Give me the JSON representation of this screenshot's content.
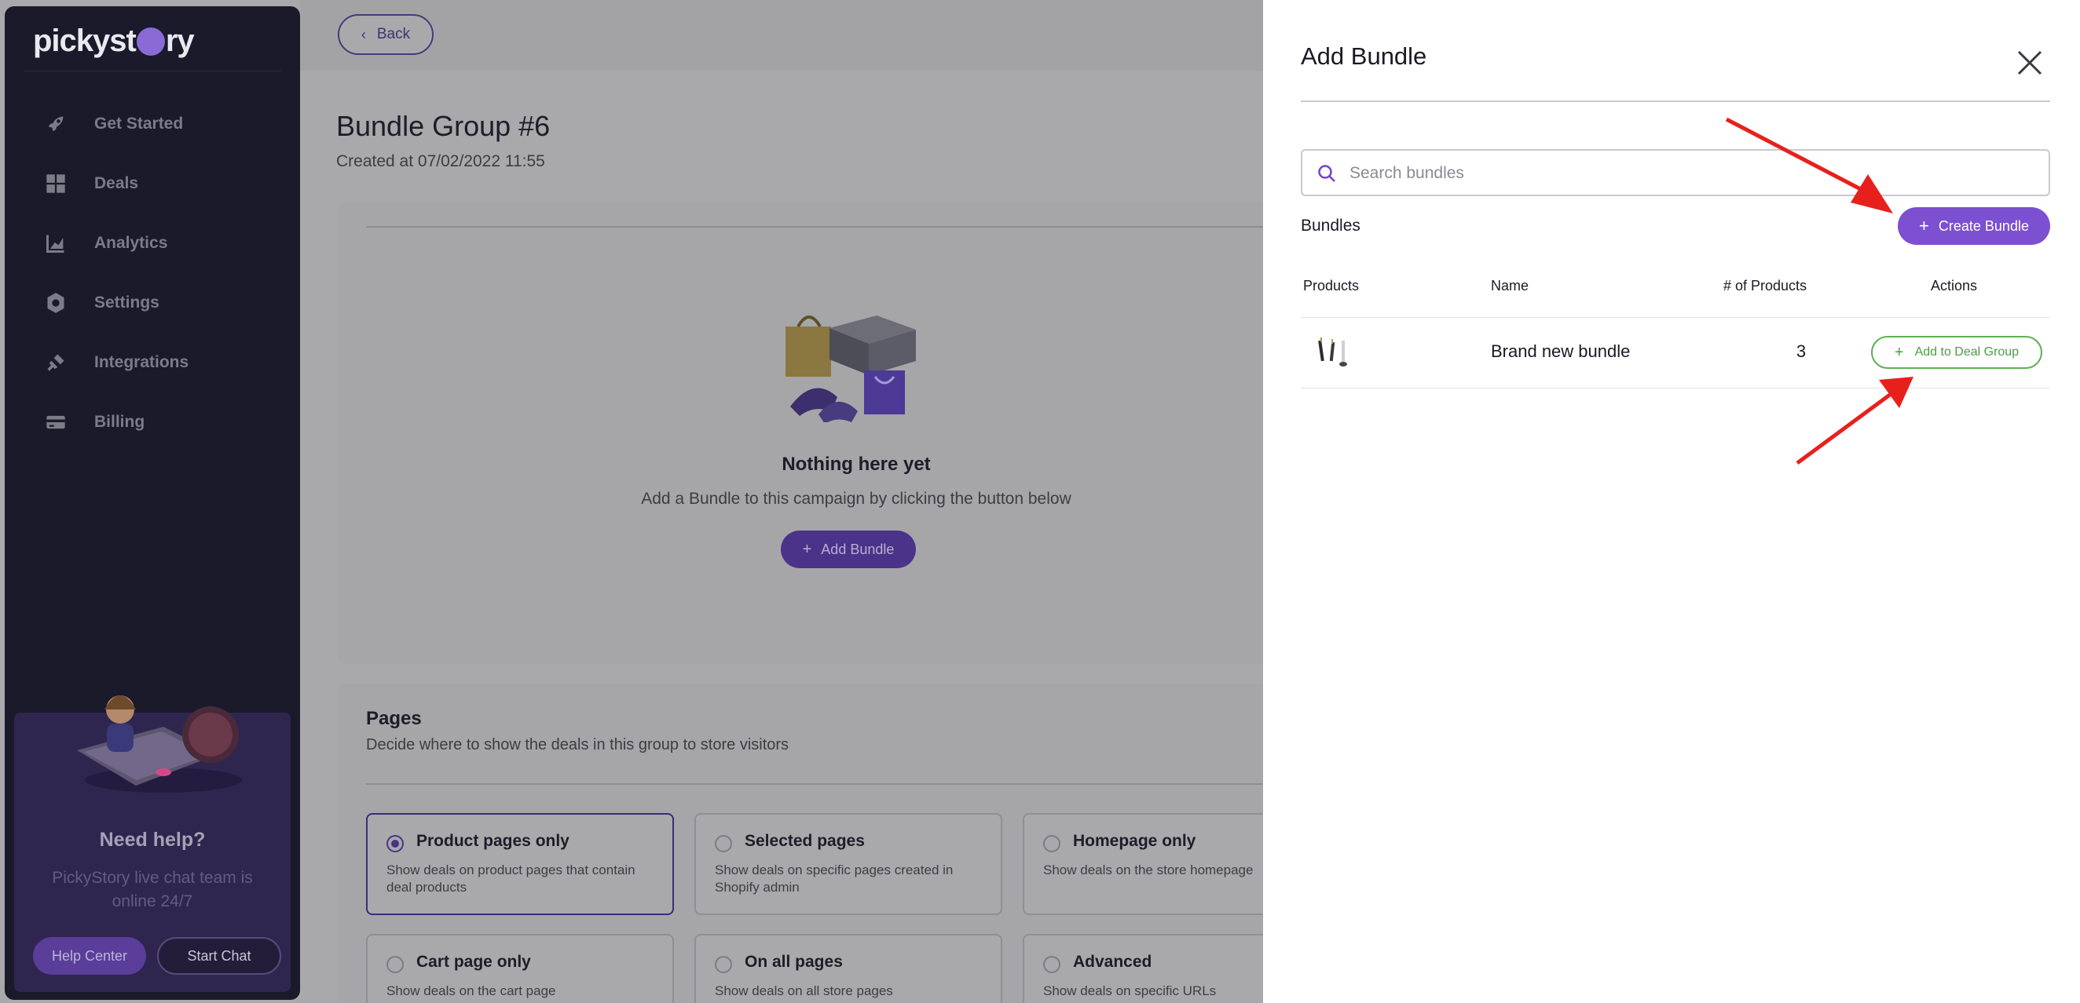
{
  "sidebar": {
    "logo": {
      "before": "pickyst",
      "after": "ry"
    },
    "items": [
      {
        "label": "Get Started",
        "icon": "rocket-icon"
      },
      {
        "label": "Deals",
        "icon": "grid-icon"
      },
      {
        "label": "Analytics",
        "icon": "chart-icon"
      },
      {
        "label": "Settings",
        "icon": "gear-icon"
      },
      {
        "label": "Integrations",
        "icon": "plug-icon"
      },
      {
        "label": "Billing",
        "icon": "card-icon"
      }
    ],
    "help": {
      "title": "Need help?",
      "text": "PickyStory live chat team is online 24/7",
      "help_center": "Help Center",
      "start_chat": "Start Chat"
    }
  },
  "main": {
    "back": "Back",
    "title": "Bundle Group #6",
    "created": "Created at 07/02/2022 11:55",
    "empty": {
      "title": "Nothing here yet",
      "text": "Add a Bundle to this campaign by clicking the button below",
      "button": "Add Bundle"
    },
    "pages": {
      "title": "Pages",
      "subtitle": "Decide where to show the deals in this group to store visitors",
      "options": [
        {
          "title": "Product pages only",
          "desc": "Show deals on product pages that contain deal products",
          "selected": true
        },
        {
          "title": "Selected pages",
          "desc": "Show deals on specific pages created in Shopify admin",
          "selected": false
        },
        {
          "title": "Homepage only",
          "desc": "Show deals on the store homepage",
          "selected": false
        },
        {
          "title": "Cart page only",
          "desc": "Show deals on the cart page",
          "selected": false
        },
        {
          "title": "On all pages",
          "desc": "Show deals on all store pages",
          "selected": false
        },
        {
          "title": "Advanced",
          "desc": "Show deals on specific URLs",
          "selected": false
        }
      ]
    }
  },
  "drawer": {
    "title": "Add Bundle",
    "search_placeholder": "Search bundles",
    "bundles_label": "Bundles",
    "create_button": "Create Bundle",
    "columns": [
      "Products",
      "Name",
      "# of Products",
      "Actions"
    ],
    "rows": [
      {
        "name": "Brand new bundle",
        "count": "3",
        "action": "Add to Deal Group"
      }
    ]
  },
  "colors": {
    "accent": "#7d4fd1",
    "sidebar_bg": "#1a1a2b",
    "success": "#5db054",
    "annotation_arrow": "#e8201c"
  }
}
